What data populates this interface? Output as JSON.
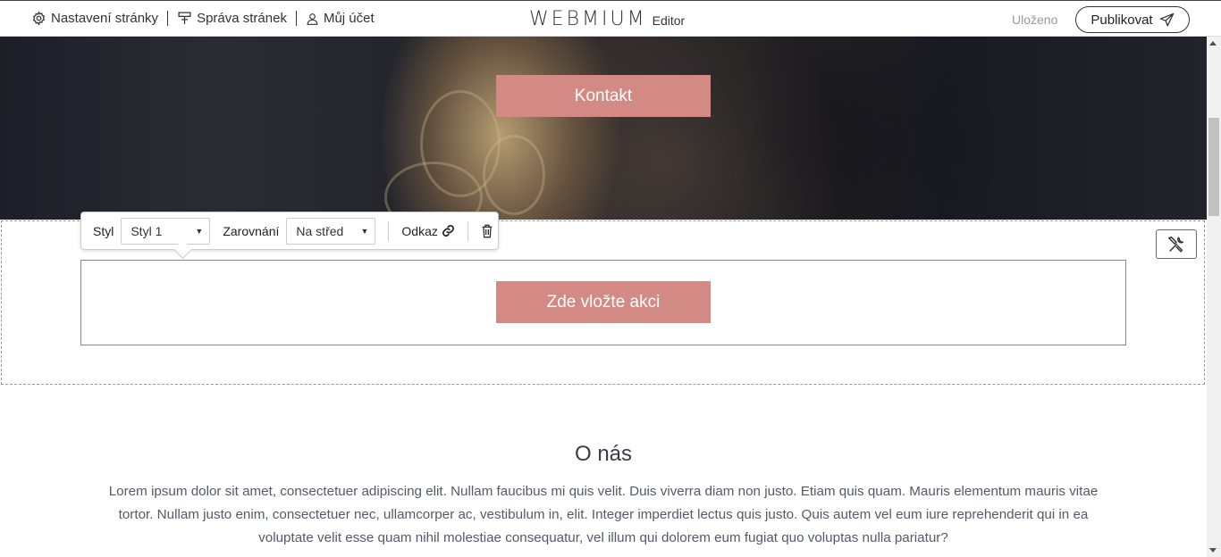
{
  "topbar": {
    "nav": [
      {
        "label": "Nastavení stránky",
        "icon": "gear-icon"
      },
      {
        "label": "Správa stránek",
        "icon": "pages-icon"
      },
      {
        "label": "Můj účet",
        "icon": "user-icon"
      }
    ],
    "logo": "WEBMIUM",
    "logo_suffix": "Editor",
    "status": "Uloženo",
    "publish_label": "Publikovat"
  },
  "hero": {
    "button_label": "Kontakt"
  },
  "toolbar": {
    "style_label": "Styl",
    "style_value": "Styl 1",
    "align_label": "Zarovnání",
    "align_value": "Na střed",
    "link_label": "Odkaz"
  },
  "cta": {
    "button_label": "Zde vložte akci"
  },
  "about": {
    "title": "O nás",
    "text": "Lorem ipsum dolor sit amet, consectetuer adipiscing elit. Nullam faucibus mi quis velit. Duis viverra diam non justo. Etiam quis quam. Mauris elementum mauris vitae tortor. Nullam justo enim, consectetuer nec, ullamcorper ac, vestibulum in, elit. Integer imperdiet lectus quis justo. Quis autem vel eum iure reprehenderit qui in ea voluptate velit esse quam nihil molestiae consequatur, vel illum qui dolorem eum fugiat quo voluptas nulla pariatur?"
  },
  "colors": {
    "accent": "#d48a84",
    "status_gray": "#999999"
  }
}
